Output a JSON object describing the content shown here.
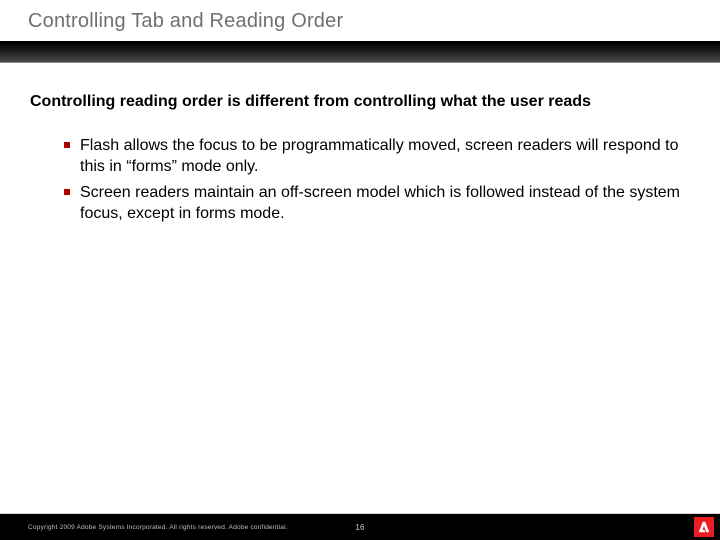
{
  "title": "Controlling Tab and Reading Order",
  "subheading": "Controlling reading order is different from controlling what the user reads",
  "bullets": [
    "Flash allows the focus to be programmatically moved, screen readers will respond to this in “forms” mode only.",
    "Screen readers maintain an off-screen model which is followed instead of the system focus, except in forms mode."
  ],
  "footer": {
    "copyright": "Copyright 2009 Adobe Systems Incorporated.  All rights reserved.  Adobe confidential.",
    "page_number": "16"
  },
  "colors": {
    "accent": "#a80000",
    "brand": "#ed1c24"
  }
}
